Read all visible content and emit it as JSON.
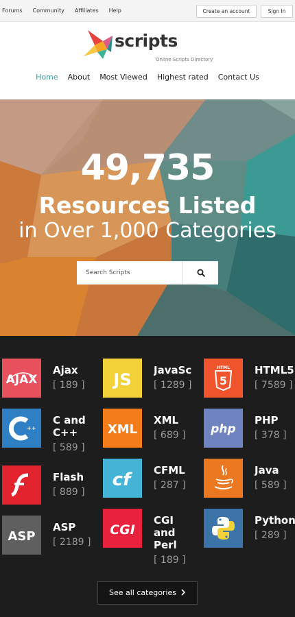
{
  "topbar": {
    "links": [
      "Forums",
      "Community",
      "Affiliates",
      "Help"
    ],
    "create_account": "Create an account",
    "sign_in": "Sign In"
  },
  "logo": {
    "word": "scripts",
    "tagline": "Online Scripts Directory"
  },
  "nav": {
    "items": [
      "Home",
      "About",
      "Most Viewed",
      "Highest rated",
      "Contact Us"
    ],
    "active": "Home",
    "active_color": "#3f9a9c"
  },
  "hero": {
    "count": "49,735",
    "line2": "Resources Listed",
    "line3": "in Over 1,000 Categories",
    "search_placeholder": "Search Scripts"
  },
  "categories": [
    {
      "name": "Ajax",
      "count": "[ 189 ]",
      "icon": "ajax-icon",
      "color": "#e9505e"
    },
    {
      "name": "JavaSc",
      "count": "[ 1289 ]",
      "icon": "js-icon",
      "color": "#f2d238"
    },
    {
      "name": "HTML5",
      "count": "[ 7589 ]",
      "icon": "html5-icon",
      "color": "#f0542c"
    },
    {
      "name": "C and\nC++",
      "count": "[ 589 ]",
      "icon": "cpp-icon",
      "color": "#2f7fc5"
    },
    {
      "name": "XML",
      "count": "[ 689 ]",
      "icon": "xml-icon",
      "color": "#f57c1b"
    },
    {
      "name": "PHP",
      "count": "[ 378 ]",
      "icon": "php-icon",
      "color": "#6f83c0"
    },
    {
      "name": "Flash",
      "count": "[ 889 ]",
      "icon": "flash-icon",
      "color": "#e2232e"
    },
    {
      "name": "CFML",
      "count": "[ 287 ]",
      "icon": "cfml-icon",
      "color": "#43b4d6"
    },
    {
      "name": "Java",
      "count": "[ 589 ]",
      "icon": "java-icon",
      "color": "#eb7820"
    },
    {
      "name": "ASP",
      "count": "[ 2189 ]",
      "icon": "asp-icon",
      "color": "#5f5f5f"
    },
    {
      "name": "CGI\nand\nPerl",
      "count": "[ 189 ]",
      "icon": "cgi-icon",
      "color": "#e8213d"
    },
    {
      "name": "Python",
      "count": "[ 289 ]",
      "icon": "python-icon",
      "color": "#3c73a8"
    }
  ],
  "see_all": "See all categories"
}
